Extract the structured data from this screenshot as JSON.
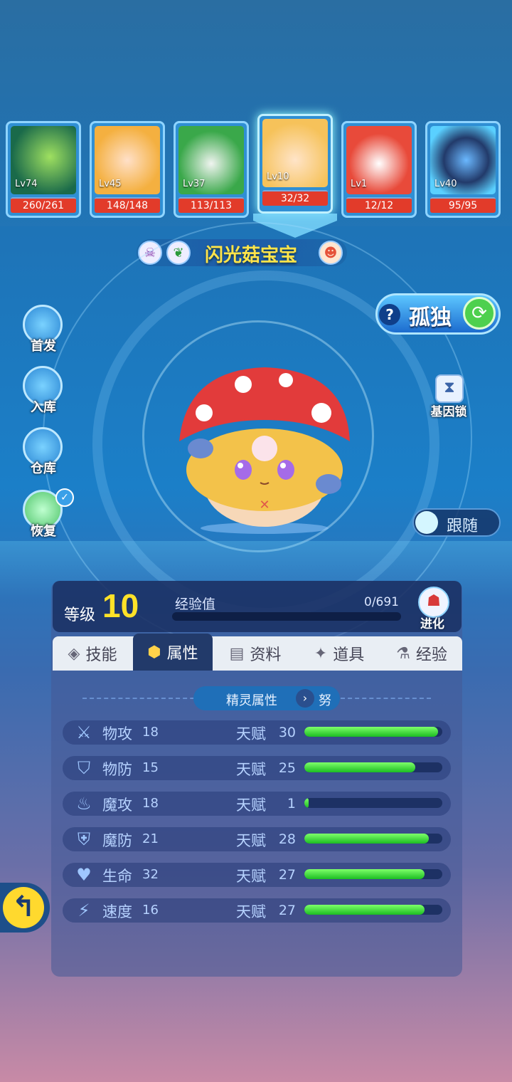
{
  "team": [
    {
      "level": "Lv74",
      "hp": "260/261",
      "portrait": "armored-robot-portrait",
      "color": "#e0a020"
    },
    {
      "level": "Lv45",
      "hp": "148/148",
      "portrait": "blonde-girl-portrait",
      "color": "#f0c060"
    },
    {
      "level": "Lv37",
      "hp": "113/113",
      "portrait": "green-hair-cat-portrait",
      "color": "#5ac86a"
    },
    {
      "level": "Lv10",
      "hp": "32/32",
      "portrait": "mushroom-baby-portrait",
      "color": "#f7c870"
    },
    {
      "level": "Lv1",
      "hp": "12/12",
      "portrait": "red-fox-portrait",
      "color": "#e84a3a"
    },
    {
      "level": "Lv40",
      "hp": "95/95",
      "portrait": "blue-mech-portrait",
      "color": "#2a4a8a"
    }
  ],
  "pet_name": "闪光菇宝宝",
  "side_buttons": [
    "首发",
    "入库",
    "仓库",
    "恢复"
  ],
  "lone_label": "孤独",
  "gene_lock": "基因锁",
  "follow": "跟随",
  "level_label": "等级",
  "level_value": "10",
  "exp_label": "经验值",
  "exp_value": "0/691",
  "exp_progress": 0,
  "evolve": "进化",
  "tabs": [
    "技能",
    "属性",
    "资料",
    "道具",
    "经验"
  ],
  "active_tab": "属性",
  "attr_header": "精灵属性",
  "nature": "努",
  "talent_label": "天赋",
  "stats": [
    {
      "name": "物攻",
      "value": "18",
      "talent": "30",
      "talent_num": 30,
      "icon": "sword-icon"
    },
    {
      "name": "物防",
      "value": "15",
      "talent": "25",
      "talent_num": 25,
      "icon": "shield-icon"
    },
    {
      "name": "魔攻",
      "value": "18",
      "talent": "1",
      "talent_num": 1,
      "icon": "flame-icon"
    },
    {
      "name": "魔防",
      "value": "21",
      "talent": "28",
      "talent_num": 28,
      "icon": "magic-shield-icon"
    },
    {
      "name": "生命",
      "value": "32",
      "talent": "27",
      "talent_num": 27,
      "icon": "heart-plus-icon"
    },
    {
      "name": "速度",
      "value": "16",
      "talent": "27",
      "talent_num": 27,
      "icon": "boot-icon"
    }
  ],
  "talent_max": 31
}
